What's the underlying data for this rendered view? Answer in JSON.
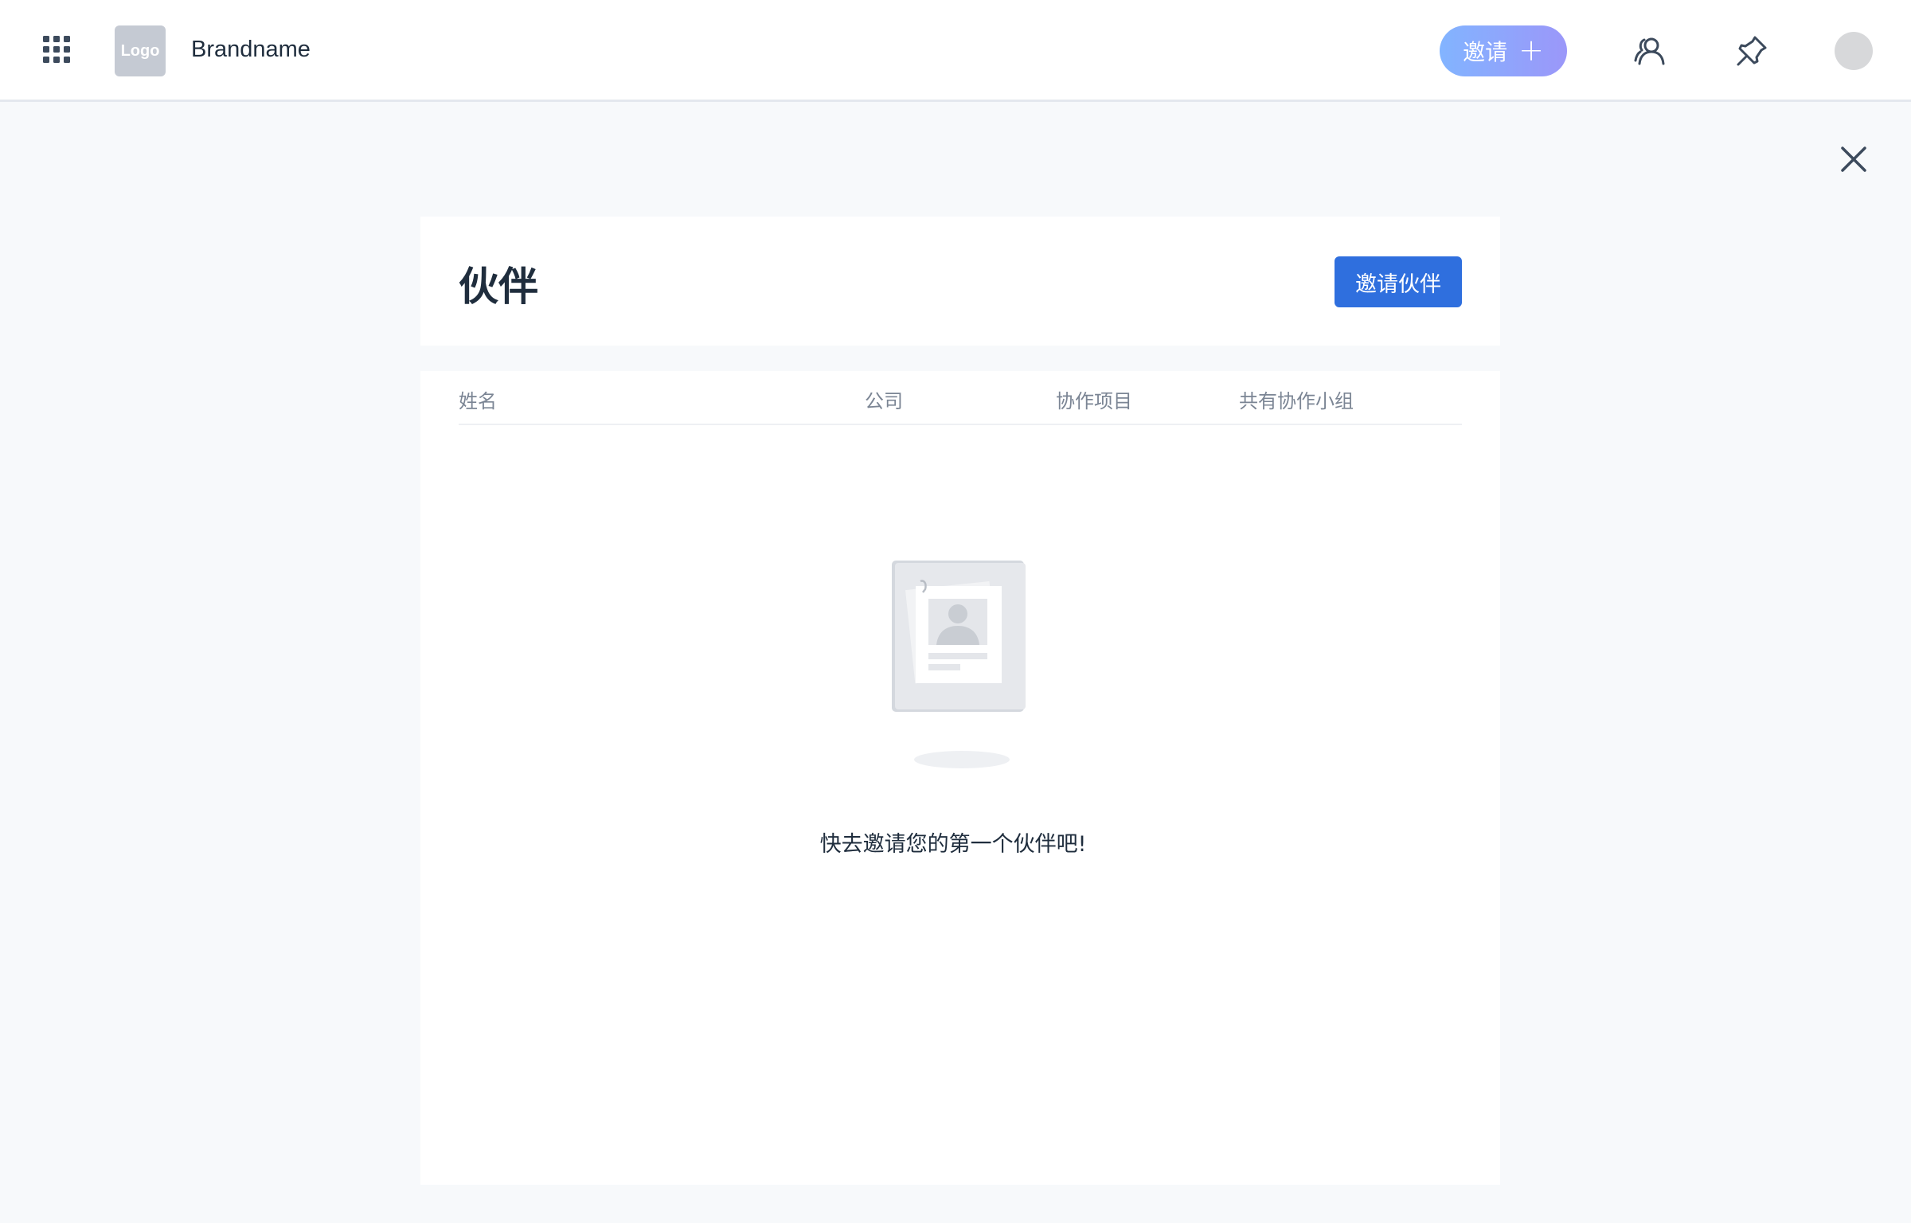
{
  "header": {
    "logo_text": "Logo",
    "brand_name": "Brandname",
    "invite_label": "邀请",
    "invite_plus": "+",
    "icons": [
      "apps-grid-icon",
      "contacts-icon",
      "pin-icon",
      "avatar"
    ]
  },
  "page": {
    "title": "伙伴",
    "invite_partner_label": "邀请伙伴"
  },
  "table": {
    "columns": [
      "姓名",
      "公司",
      "协作项目",
      "共有协作小组"
    ],
    "rows": []
  },
  "empty_state": {
    "message": "快去邀请您的第一个伙伴吧!"
  },
  "colors": {
    "primary": "#2f6fde",
    "invite_gradient_start": "#82b4ff",
    "invite_gradient_end": "#9b97f9",
    "page_bg": "#f7f9fb",
    "text": "#1f2d3d",
    "muted_text": "#7b8594"
  }
}
